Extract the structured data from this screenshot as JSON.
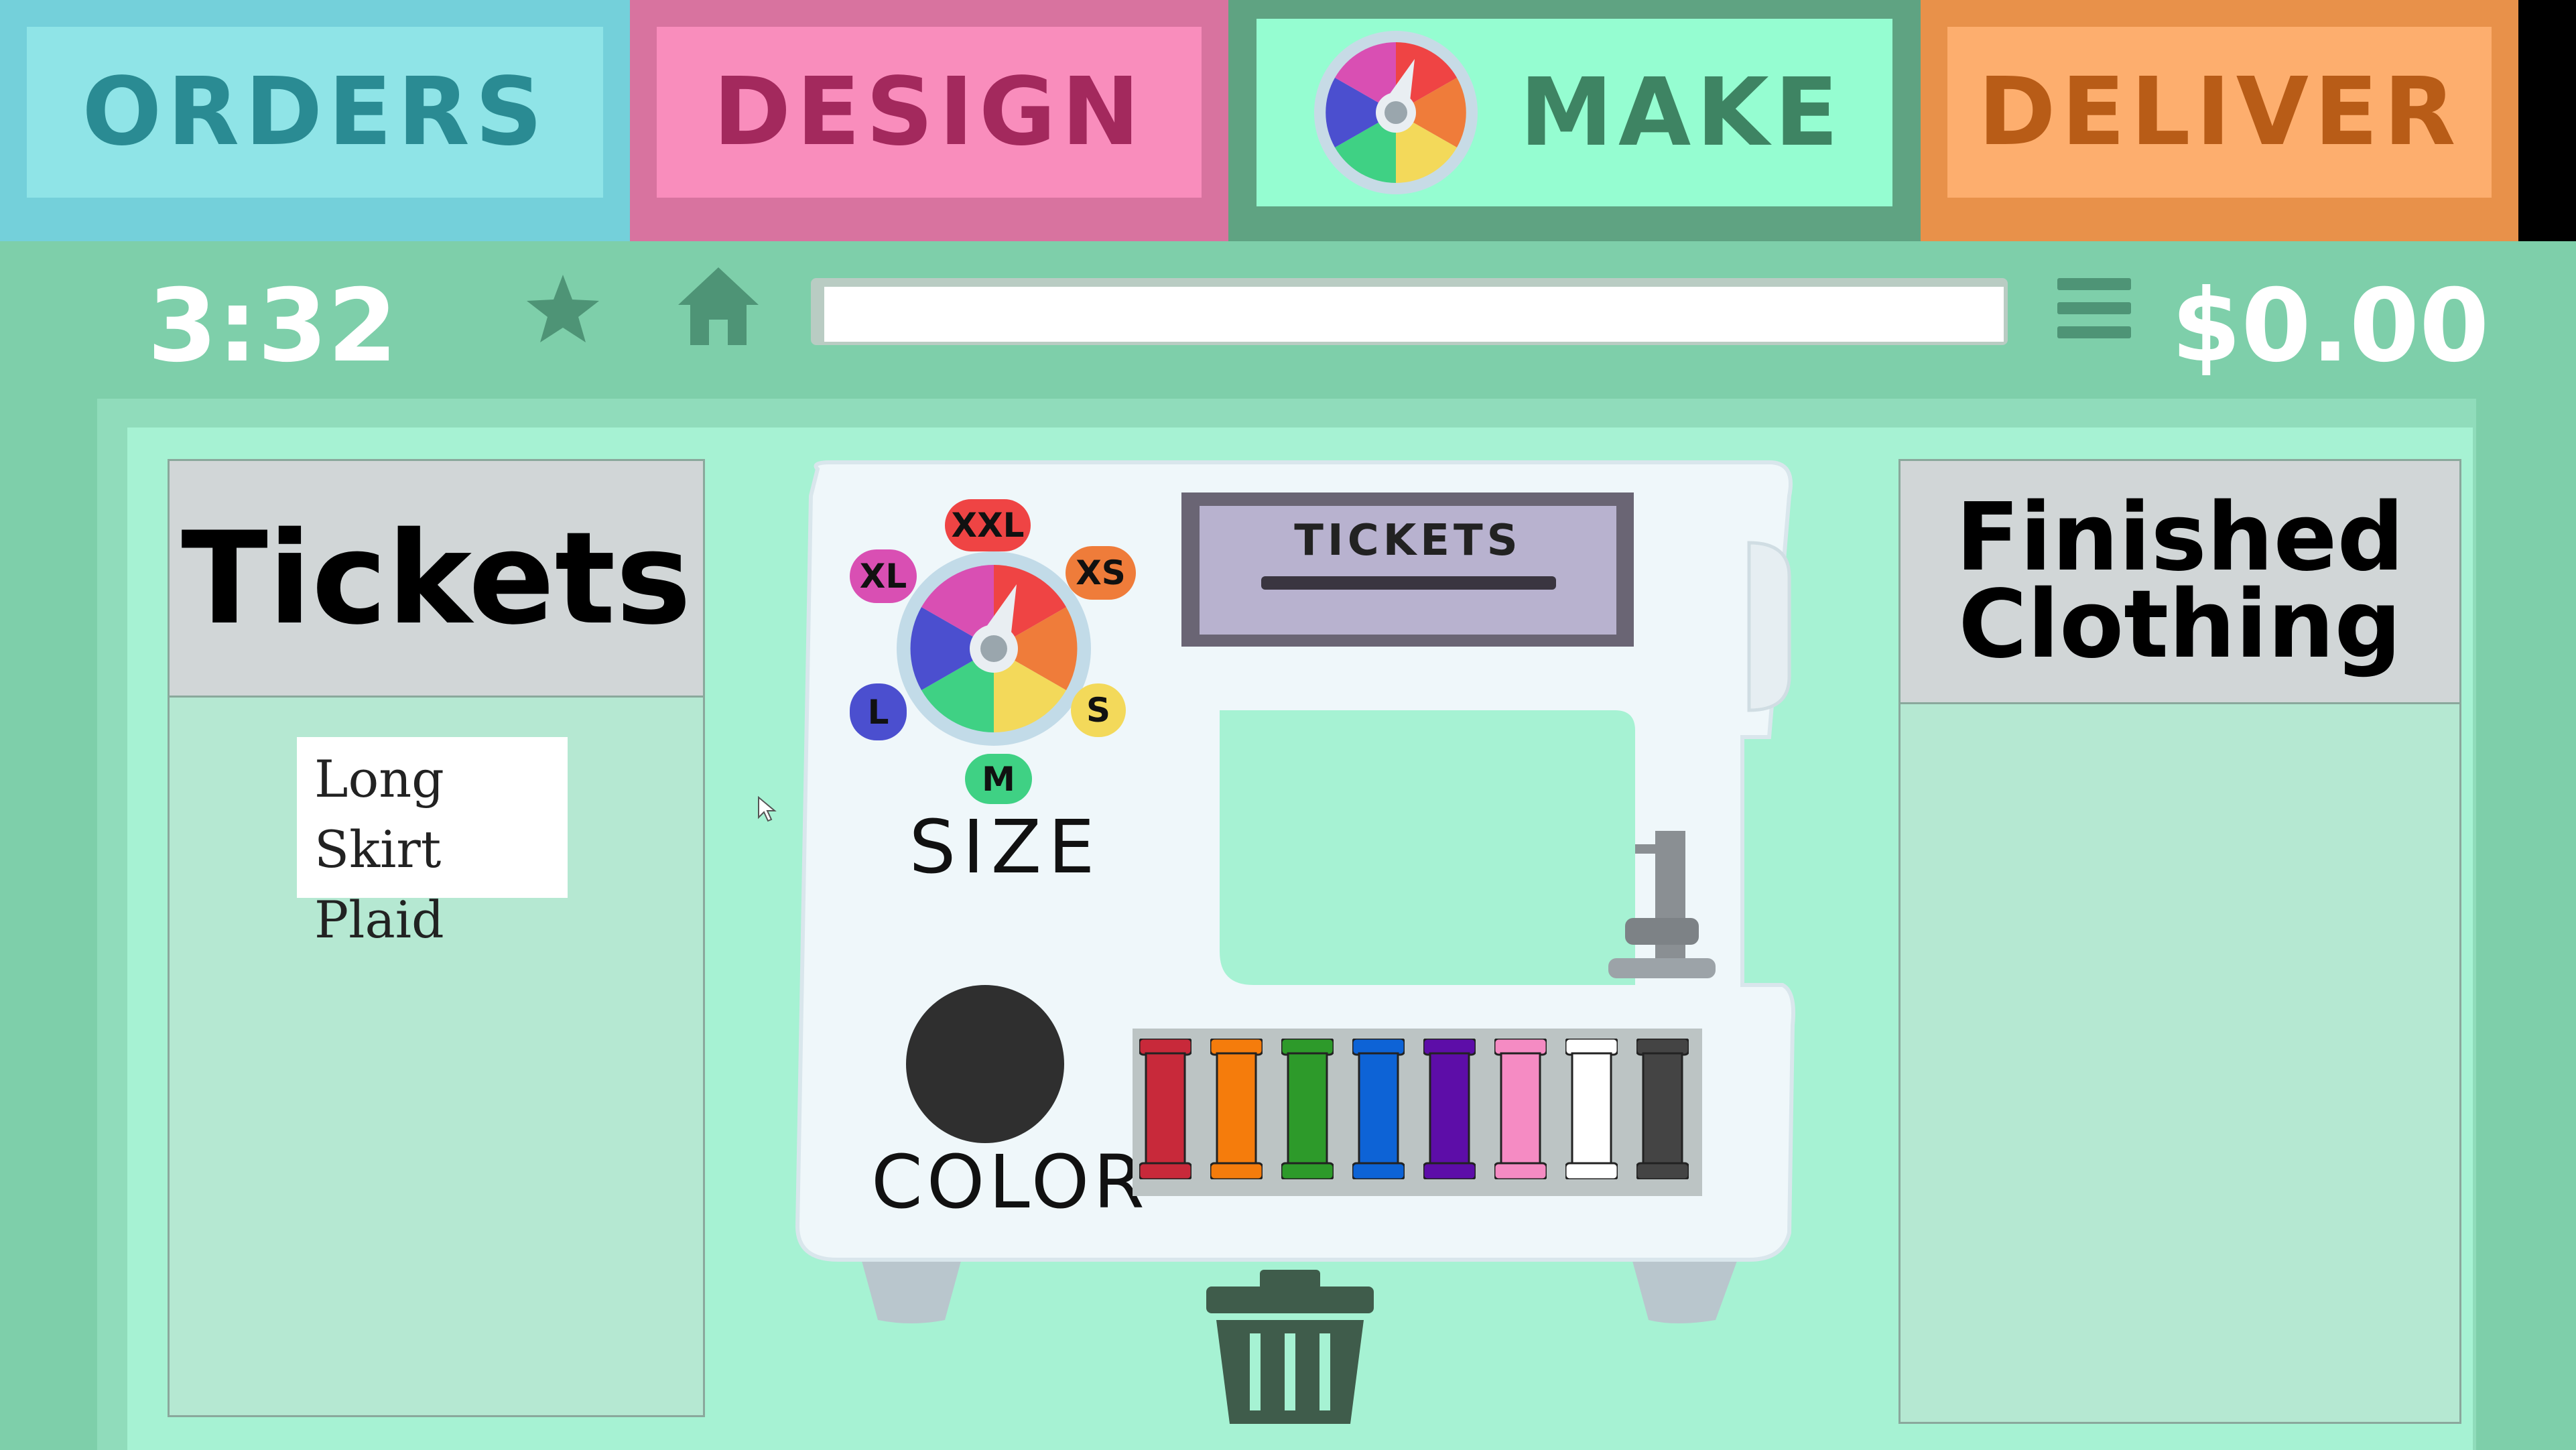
{
  "tabs": {
    "orders": "ORDERS",
    "design": "DESIGN",
    "make": "MAKE",
    "deliver": "DELIVER"
  },
  "toolbar": {
    "timer": "3:32",
    "money": "$0.00",
    "star_icon": "star-icon",
    "home_icon": "home-icon",
    "menu_icon": "menu-icon"
  },
  "tickets_panel": {
    "title": "Tickets",
    "ticket": {
      "line1": "Long Skirt",
      "line2": "Plaid"
    }
  },
  "finished_panel": {
    "title_line1": "Finished",
    "title_line2": "Clothing"
  },
  "machine": {
    "plate_label": "TICKETS",
    "size_label": "SIZE",
    "color_label": "COLOR",
    "sizes": [
      "XXL",
      "XS",
      "S",
      "M",
      "L",
      "XL"
    ],
    "selected_color": "#2f2f2f",
    "spools": [
      "#c8293a",
      "#f57c0c",
      "#2d9a2a",
      "#0d63d6",
      "#5d0da8",
      "#f58bc3",
      "#ffffff",
      "#444444"
    ]
  },
  "colors": {
    "orders": "#8fe4e7",
    "design": "#f98dbc",
    "make": "#95fdd1",
    "deliver": "#fdae6e",
    "background": "#7ecfaa"
  }
}
